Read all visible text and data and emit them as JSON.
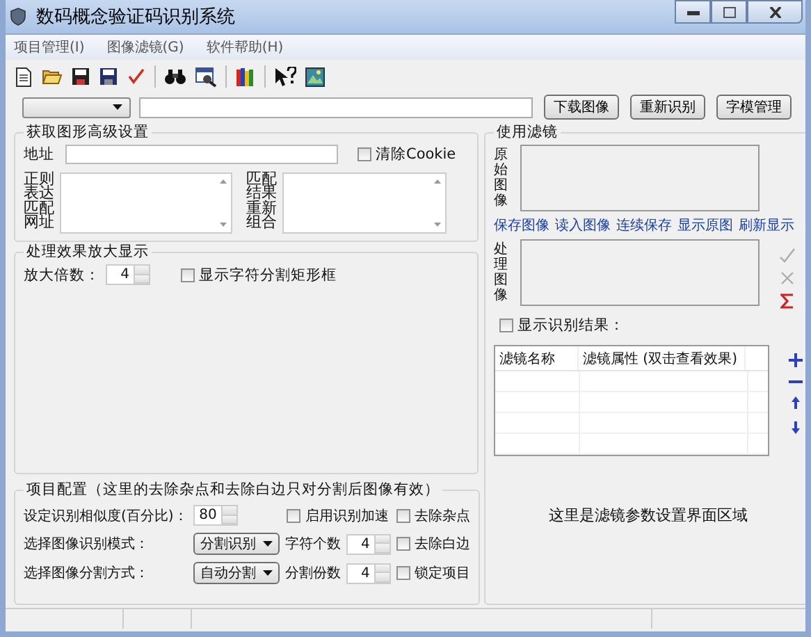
{
  "window": {
    "title": "数码概念验证码识别系统"
  },
  "menu": [
    {
      "label": "项目管理(I)"
    },
    {
      "label": "图像滤镜(G)"
    },
    {
      "label": "软件帮助(H)"
    }
  ],
  "address_bar": {
    "buttons": [
      "下载图像",
      "重新识别",
      "字模管理"
    ]
  },
  "fetch_settings": {
    "title": "获取图形高级设置",
    "address_label": "地址",
    "clear_cookie": {
      "label": "清除Cookie",
      "checked": false
    },
    "regex_label": "正则表达匹配网址",
    "recombine_label": "匹配结果重新组合"
  },
  "zoom_display": {
    "title": "处理效果放大显示",
    "zoom_label": "放大倍数：",
    "zoom_value": "4",
    "show_boxes": {
      "label": "显示字符分割矩形框",
      "checked": false
    }
  },
  "project_config": {
    "title": "项目配置（这里的去除杂点和去除白边只对分割后图像有效）",
    "similarity_label": "设定识别相似度(百分比)：",
    "similarity_value": "80",
    "mode_label": "选择图像识别模式：",
    "mode_value": "分割识别",
    "split_label": "选择图像分割方式：",
    "split_value": "自动分割",
    "char_count_label": "字符个数",
    "char_count_value": "4",
    "split_count_label": "分割份数",
    "split_count_value": "4",
    "checkboxes": [
      {
        "label": "启用识别加速",
        "checked": false
      },
      {
        "label": "去除杂点",
        "checked": false
      },
      {
        "label": "去除白边",
        "checked": false
      },
      {
        "label": "锁定项目",
        "checked": false
      }
    ]
  },
  "filters": {
    "title": "使用滤镜",
    "original_label": "原始图像",
    "links": [
      "保存图像",
      "读入图像",
      "连续保存",
      "显示原图",
      "刷新显示"
    ],
    "processed_label": "处理图像",
    "show_result": {
      "label": "显示识别结果：",
      "checked": false
    },
    "table": {
      "columns": [
        "滤镜名称",
        "滤镜属性 (双击查看效果)"
      ]
    },
    "param_note": "这里是滤镜参数设置界面区域"
  }
}
